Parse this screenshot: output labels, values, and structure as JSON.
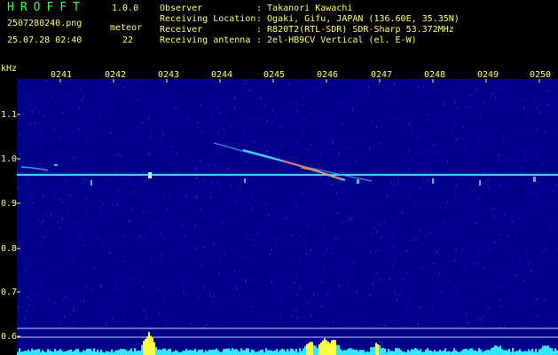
{
  "header": {
    "app_name": "HROFFT",
    "version": "1.0.0",
    "filename": "2507280240.png",
    "datetime": "25.07.28 02:40",
    "meteor_label": "meteor",
    "meteor_count": "22"
  },
  "info": [
    {
      "key": "Observer",
      "value": ": Takanori Kawachi"
    },
    {
      "key": "Receiving Location",
      "value": ": Ogaki, Gifu, JAPAN (136.60E, 35.35N)"
    },
    {
      "key": "Receiver",
      "value": ": R820T2(RTL-SDR) SDR-Sharp 53.372MHz"
    },
    {
      "key": "Receiving antenna",
      "value": ": 2el-HB9CV Vertical (el. E-W)"
    }
  ],
  "axis": {
    "y_unit": "kHz",
    "x_ticks": [
      "0241",
      "0242",
      "0243",
      "0244",
      "0245",
      "0246",
      "0247",
      "0248",
      "0249",
      "0250"
    ],
    "y_ticks": [
      "1.1",
      "1.0",
      "0.9",
      "0.8",
      "0.7",
      "0.6"
    ]
  },
  "colors": {
    "text": "#ffff66",
    "app_name": "#33ff33",
    "background_noise": "#00008a",
    "carrier": "#38d8ff",
    "meteor_echo": "#ff6060"
  }
}
